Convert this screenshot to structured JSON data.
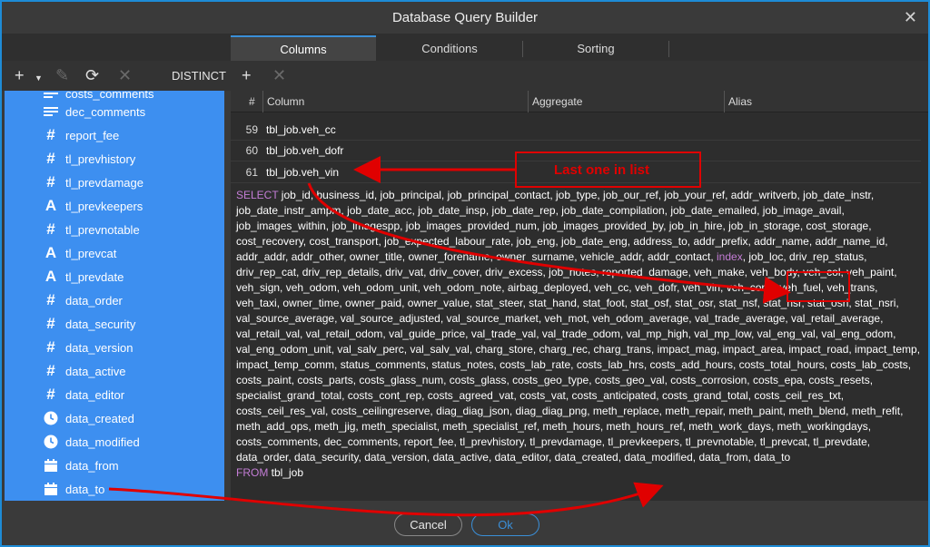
{
  "window": {
    "title": "Database Query Builder",
    "close_glyph": "✕"
  },
  "tabs": [
    {
      "label": "Columns",
      "active": true
    },
    {
      "label": "Conditions",
      "active": false
    },
    {
      "label": "Sorting",
      "active": false
    }
  ],
  "toolbar": {
    "distinct_label": "DISTINCT"
  },
  "sidebar": {
    "items": [
      {
        "label": "costs_comments",
        "icon": "text-lines-icon"
      },
      {
        "label": "dec_comments",
        "icon": "text-lines-icon"
      },
      {
        "label": "report_fee",
        "icon": "hash-icon"
      },
      {
        "label": "tl_prevhistory",
        "icon": "hash-icon"
      },
      {
        "label": "tl_prevdamage",
        "icon": "hash-icon"
      },
      {
        "label": "tl_prevkeepers",
        "icon": "text-a-icon"
      },
      {
        "label": "tl_prevnotable",
        "icon": "hash-icon"
      },
      {
        "label": "tl_prevcat",
        "icon": "text-a-icon"
      },
      {
        "label": "tl_prevdate",
        "icon": "text-a-icon"
      },
      {
        "label": "data_order",
        "icon": "hash-icon"
      },
      {
        "label": "data_security",
        "icon": "hash-icon"
      },
      {
        "label": "data_version",
        "icon": "hash-icon"
      },
      {
        "label": "data_active",
        "icon": "hash-icon"
      },
      {
        "label": "data_editor",
        "icon": "hash-icon"
      },
      {
        "label": "data_created",
        "icon": "clock-icon"
      },
      {
        "label": "data_modified",
        "icon": "clock-icon"
      },
      {
        "label": "data_from",
        "icon": "calendar-icon"
      },
      {
        "label": "data_to",
        "icon": "calendar-icon"
      }
    ]
  },
  "grid": {
    "headers": {
      "num": "#",
      "column": "Column",
      "aggregate": "Aggregate",
      "alias": "Alias"
    },
    "rows": [
      {
        "num": "59",
        "column": "tbl_job.veh_cc"
      },
      {
        "num": "60",
        "column": "tbl_job.veh_dofr"
      },
      {
        "num": "61",
        "column": "tbl_job.veh_vin"
      }
    ]
  },
  "sql": {
    "select_kw": "SELECT",
    "body_before_index": " job_id, business_id, job_principal, job_principal_contact, job_type, job_our_ref, job_your_ref, addr_writverb, job_date_instr, job_date_instr_ampm, job_date_acc, job_date_insp, job_date_rep, job_date_compilation, job_date_emailed, job_image_avail, job_images_within, job_imagespp, job_images_provided_num, job_images_provided_by, job_in_hire, job_in_storage, cost_storage, cost_recovery, cost_transport, job_expected_labour_rate, job_eng, job_date_eng, address_to, addr_prefix, addr_name, addr_name_id, addr_addr, addr_other, owner_title, owner_forename, owner_surname, vehicle_addr, addr_contact, ",
    "index_kw": "index",
    "body_after_index": ", job_loc, driv_rep_status, driv_rep_cat, driv_rep_details, driv_vat, driv_cover, driv_excess, job_notes, reported_damage, veh_make, veh_body, veh_col, veh_paint, veh_sign, veh_odom, veh_odom_unit, veh_odom_note, airbag_deployed, veh_cc, veh_dofr, veh_vin, veh_cond, veh_fuel, veh_trans, veh_taxi, owner_time, owner_paid, owner_value, stat_steer, stat_hand, stat_foot, stat_osf, stat_osr, stat_nsf, stat_nsr, stat_osri, stat_nsri, val_source_average, val_source_adjusted, val_source_market, veh_mot, veh_odom_average, val_trade_average, val_retail_average, val_retail_val, val_retail_odom, val_guide_price, val_trade_val, val_trade_odom, val_mp_high, val_mp_low, val_eng_val, val_eng_odom, val_eng_odom_unit, val_salv_perc, val_salv_val, charg_store, charg_rec, charg_trans, impact_mag, impact_area, impact_road, impact_temp, impact_temp_comm, status_comments, status_notes, costs_lab_rate, costs_lab_hrs, costs_add_hours, costs_total_hours, costs_lab_costs, costs_paint, costs_parts, costs_glass_num, costs_glass, costs_geo_type, costs_geo_val, costs_corrosion, costs_epa, costs_resets, specialist_grand_total, costs_cont_rep, costs_agreed_vat, costs_vat, costs_anticipated, costs_grand_total, costs_ceil_res_txt, costs_ceil_res_val, costs_ceilingreserve, diag_diag_json, diag_diag_png, meth_replace, meth_repair, meth_paint, meth_blend, meth_refit, meth_add_ops, meth_jig, meth_specialist, meth_specialist_ref, meth_hours, meth_hours_ref, meth_work_days, meth_workingdays, costs_comments, dec_comments, report_fee, tl_prevhistory, tl_prevdamage, tl_prevkeepers, tl_prevnotable, tl_prevcat, tl_prevdate, data_order, data_security, data_version, data_active, data_editor, data_created, data_modified, data_from, data_to",
    "from_kw": "FROM",
    "from_table": " tbl_job"
  },
  "footer": {
    "cancel_label": "Cancel",
    "ok_label": "Ok"
  },
  "annotation": {
    "note": "Last one in list",
    "color": "#e00000"
  }
}
